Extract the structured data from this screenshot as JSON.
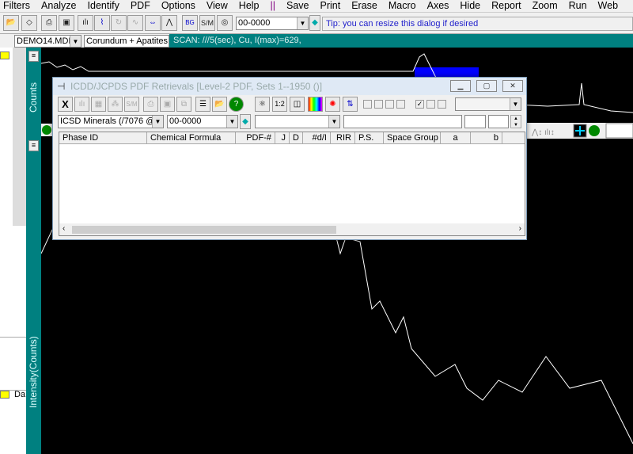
{
  "menu": [
    "Filters",
    "Analyze",
    "Identify",
    "PDF",
    "Options",
    "View",
    "Help",
    "||",
    "Save",
    "Print",
    "Erase",
    "Macro",
    "Axes",
    "Hide",
    "Report",
    "Zoom",
    "Run",
    "Web"
  ],
  "toolbar": {
    "pdf_combo": "00-0000",
    "tip": "Tip: you can resize this dialog if desired"
  },
  "row3": {
    "file_combo": "DEMO14.MDI",
    "phase_field": "Corundum + Apatites",
    "scan_info": "SCAN: ///5(sec), Cu, I(max)=629,"
  },
  "plot": {
    "upper_axis_label": "Counts",
    "lower_axis_label": "Intensity(Counts)",
    "background": "#000000",
    "axis_strip_color": "#008080",
    "line_color": "#ffffff",
    "highlight_color": "#0000ff",
    "left_tab_label": "Da"
  },
  "dialog": {
    "title": "ICDD/JCPDS PDF Retrievals [Level-2 PDF, Sets 1--1950 ()]",
    "database_combo": "ICSD Minerals (/7076 @)",
    "pdf_combo": "00-0000",
    "ratio_button": "1:2",
    "close_button": "X",
    "columns": [
      "Phase ID",
      "Chemical Formula",
      "PDF-#",
      "J",
      "D",
      "#d/I",
      "RIR",
      "P.S.",
      "Space Group",
      "a",
      "b"
    ]
  }
}
